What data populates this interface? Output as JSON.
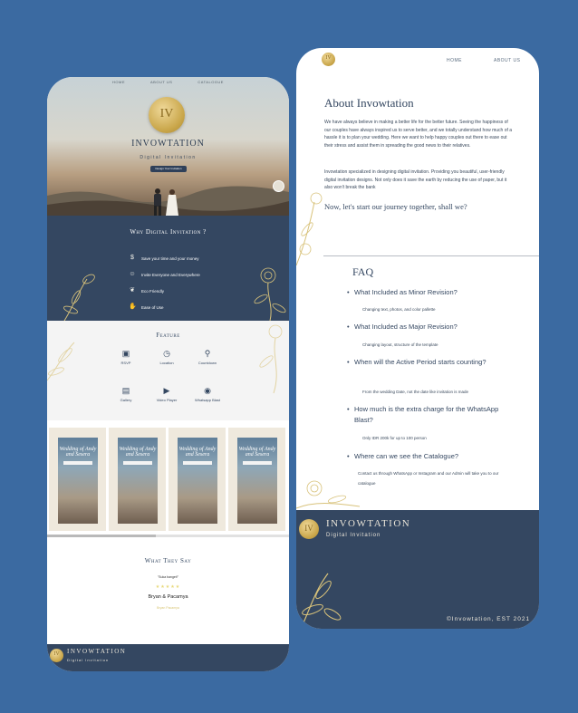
{
  "left_page": {
    "nav": [
      "HOME",
      "ABOUT US",
      "CATALOGUE"
    ],
    "hero": {
      "title": "Invowtation",
      "subtitle": "Digital Invitation",
      "button": "Design Your Invitation",
      "seal_letters": "IV"
    },
    "why": {
      "title": "Why Digital Invitation ?",
      "items": [
        {
          "icon": "money-icon",
          "label": "Save your time and your money"
        },
        {
          "icon": "people-icon",
          "label": "Invite Everyone and Everywhere"
        },
        {
          "icon": "leaf-icon",
          "label": "Eco Friendly"
        },
        {
          "icon": "hand-icon",
          "label": "Ease of Use"
        }
      ]
    },
    "feature": {
      "title": "Feature",
      "items": [
        {
          "icon": "rsvp-icon",
          "glyph": "▣",
          "label": "RSVP"
        },
        {
          "icon": "location-icon",
          "glyph": "◷",
          "label": "Location"
        },
        {
          "icon": "countdown-icon",
          "glyph": "⚲",
          "label": "Countdown"
        },
        {
          "icon": "gallery-icon",
          "glyph": "▤",
          "label": "Gallery"
        },
        {
          "icon": "video-player-icon",
          "glyph": "▶",
          "label": "Video Player"
        },
        {
          "icon": "whatsapp-icon",
          "glyph": "◉",
          "label": "Whatsapp Blast"
        }
      ]
    },
    "gallery": {
      "card_text": "Wedding of Andy and Sesera"
    },
    "testimonial": {
      "title": "What They Say",
      "quote": "\"Suka banget!\"",
      "stars": "★★★★★",
      "name": "Bryan & Pacamya",
      "subtitle": "Bryan Pacamya"
    },
    "footer": {
      "brand": "Invowtation",
      "tagline": "Digital Invitation"
    }
  },
  "right_page": {
    "nav": {
      "home": "HOME",
      "about": "ABOUT US"
    },
    "about": {
      "title": "About Invowtation",
      "para1": "We have always believe in making a better life for the better future. Seeing the happiness of our couples have always inspired us to serve better, and we totally understand how much of a hassle it is to plan your wedding. Here we want to help happy couples out there to ease out their stress and assist them in spreading the good news to their relatives.",
      "para2": "Invowtation specialized in designing digital invitation. Providing you beautiful, user-friendly digital invitation designs. Not only does it save the earth by reducing the use of paper, but it also won't break the bank",
      "tagline": "Now, let's start our journey together, shall we?"
    },
    "faq": {
      "title": "FAQ",
      "items": [
        {
          "q": "What Included as Minor Revision?",
          "a": "Changing text, photos, and color pallette"
        },
        {
          "q": "What Included as Major Revision?",
          "a": "Changing layout, structure of the template"
        },
        {
          "q": "When will the Active Period starts counting?",
          "a": "From the wedding Date, not the date like invitation is made"
        },
        {
          "q": "How much is the extra charge for the WhatsApp Blast?",
          "a": "Only IDR 200k for up to 100 person"
        },
        {
          "q": "Where can we see the Catalogue?",
          "a": "Contact us through WhatsApp or Instagram and our Admin will take you   to our catalogue"
        }
      ]
    },
    "footer": {
      "brand": "Invowtation",
      "tagline": "Digital Invitation",
      "copyright": "©Invowtation, EST 2021"
    }
  },
  "colors": {
    "background": "#3b6aa1",
    "navy": "#344761",
    "gold": "#d8c27a",
    "seal": "#c9a64a"
  }
}
